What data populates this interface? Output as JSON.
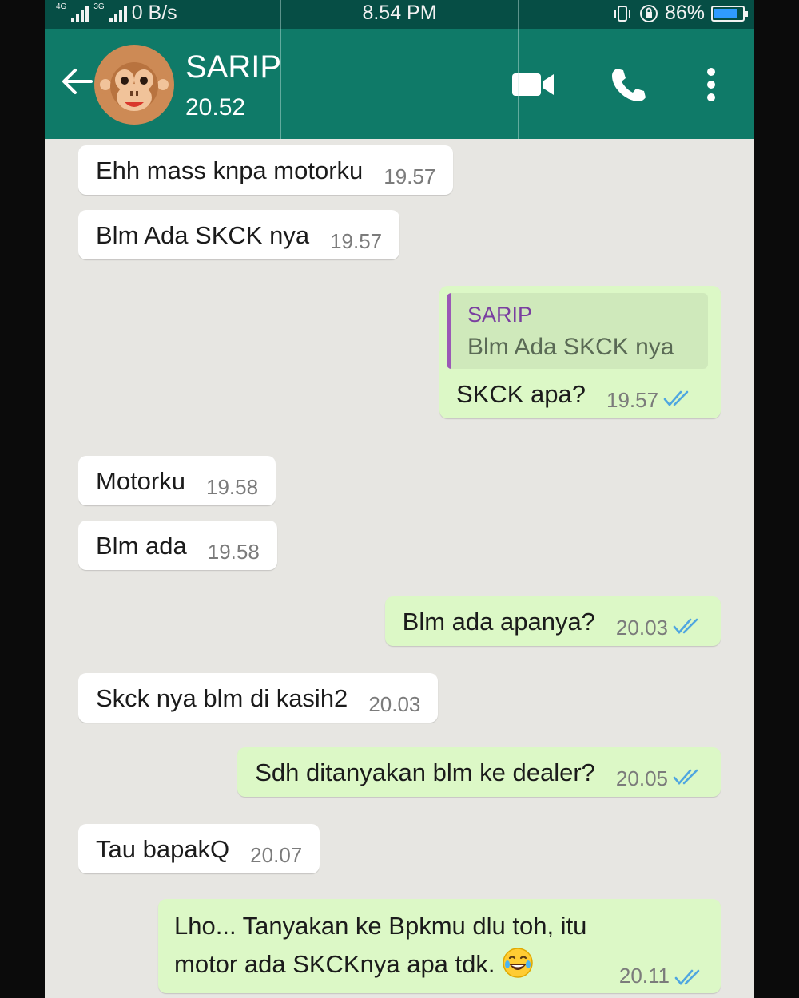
{
  "status_bar": {
    "network_labels": [
      "4G",
      "3G"
    ],
    "speed": "0 B/s",
    "time": "8.54 PM",
    "battery": "86%",
    "battery_level": 0.86
  },
  "header": {
    "contact_name": "SARIP",
    "status": "20.52",
    "icons": [
      "back-arrow-icon",
      "monkey-avatar",
      "video-call-icon",
      "phone-icon",
      "more-options-icon"
    ]
  },
  "messages": [
    {
      "dir": "in",
      "text": "Ehh mass knpa motorku",
      "time": "19.57"
    },
    {
      "dir": "in",
      "text": "Blm Ada SKCK nya",
      "time": "19.57"
    },
    {
      "dir": "out",
      "quote_author": "SARIP",
      "quote_text": "Blm Ada SKCK nya",
      "text": "SKCK apa?",
      "time": "19.57"
    },
    {
      "dir": "in",
      "text": "Motorku",
      "time": "19.58"
    },
    {
      "dir": "in",
      "text": "Blm ada",
      "time": "19.58"
    },
    {
      "dir": "out",
      "text": "Blm ada apanya?",
      "time": "20.03"
    },
    {
      "dir": "in",
      "text": "Skck nya blm di kasih2",
      "time": "20.03"
    },
    {
      "dir": "out",
      "text": "Sdh ditanyakan blm ke dealer?",
      "time": "20.05"
    },
    {
      "dir": "in",
      "text": "Tau bapakQ",
      "time": "20.07"
    },
    {
      "dir": "out",
      "text_line1": "Lho... Tanyakan ke Bpkmu dlu toh, itu",
      "text_line2": "motor ada SKCKnya apa tdk.",
      "time": "20.11"
    }
  ],
  "colors": {
    "appbar": "#0f7a68",
    "statusbar": "#064e45",
    "incoming": "#ffffff",
    "outgoing": "#dcf8c6",
    "read_ticks": "#4fa6e0"
  }
}
